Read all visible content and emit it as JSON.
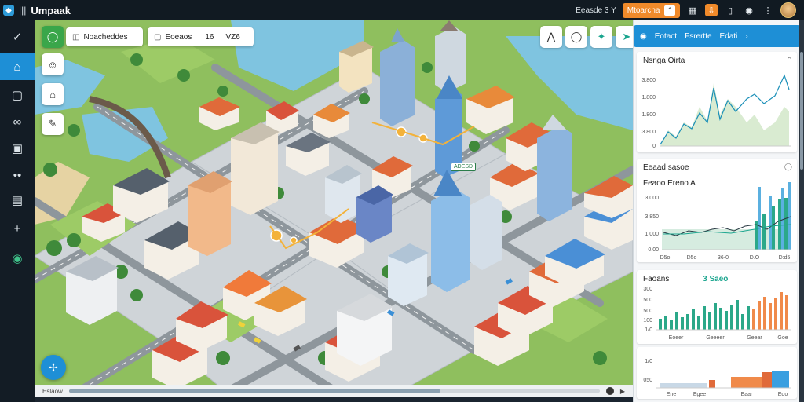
{
  "app": {
    "title": "Umpaak"
  },
  "topbar": {
    "label": "Eeasde 3 Y",
    "orange_button": "Mtoarcha",
    "icons": [
      "grid-icon",
      "download-icon",
      "phone-icon",
      "settings-icon",
      "more-icon"
    ]
  },
  "sidebar": {
    "items": [
      {
        "name": "check-icon",
        "glyph": "✓"
      },
      {
        "name": "home-icon",
        "glyph": "⌂"
      },
      {
        "name": "box-icon",
        "glyph": "▢"
      },
      {
        "name": "link-icon",
        "glyph": "∞"
      },
      {
        "name": "image-icon",
        "glyph": "▣"
      },
      {
        "name": "dots-icon",
        "glyph": "••"
      },
      {
        "name": "layers-icon",
        "glyph": "▤"
      },
      {
        "name": "plus-icon",
        "glyph": "+"
      },
      {
        "name": "shield-icon",
        "glyph": "◉"
      }
    ],
    "active_index": 1
  },
  "map": {
    "chip_search": "Noacheddes",
    "chip_filter_a": "Eoeaos",
    "chip_filter_num": "16",
    "chip_filter_b": "VZ6",
    "building_tag": "ADESD",
    "left_controls": [
      "marker-icon",
      "bank-icon",
      "brush-icon"
    ],
    "tool_buttons": [
      "cone-icon",
      "circle-icon",
      "pin-icon",
      "cursor-icon"
    ]
  },
  "timeline": {
    "start_label": "Eslaow",
    "progress": 0.7
  },
  "panel": {
    "header": {
      "item1": "Eotact",
      "item2": "Fsrertte",
      "item3": "Edati"
    },
    "card1": {
      "title": "Nsnga Oirta",
      "y_ticks": [
        "3.800",
        "1.800",
        "1.800",
        "3.800",
        "0"
      ]
    },
    "card2": {
      "title": "Eeaad sasoe",
      "subtitle": "Feaoo Ereno",
      "subtitle_mark": "A",
      "y_ticks": [
        "3.000",
        "3.850",
        "1.000",
        "0.00"
      ],
      "x_ticks": [
        "D5o",
        "D5o",
        "36-0",
        "D.O",
        "D:d5"
      ]
    },
    "card3": {
      "title": "Faoans",
      "highlight": "3 Saeo",
      "y_ticks": [
        "300",
        "500",
        "500",
        "100",
        "1/0"
      ],
      "x_ticks": [
        "Eoeer",
        "Geeeer",
        "Geear",
        "Goe"
      ]
    },
    "card4": {
      "y_ticks": [
        "1/0",
        "050"
      ],
      "x_ticks": [
        "Ene",
        "Egee",
        "Eaar",
        "Eoo"
      ]
    }
  },
  "colors": {
    "accent": "#1e8fd6",
    "orange": "#f08a2a",
    "teal": "#1aa58e",
    "grass": "#8fbf5e",
    "water": "#7fc4e0"
  }
}
